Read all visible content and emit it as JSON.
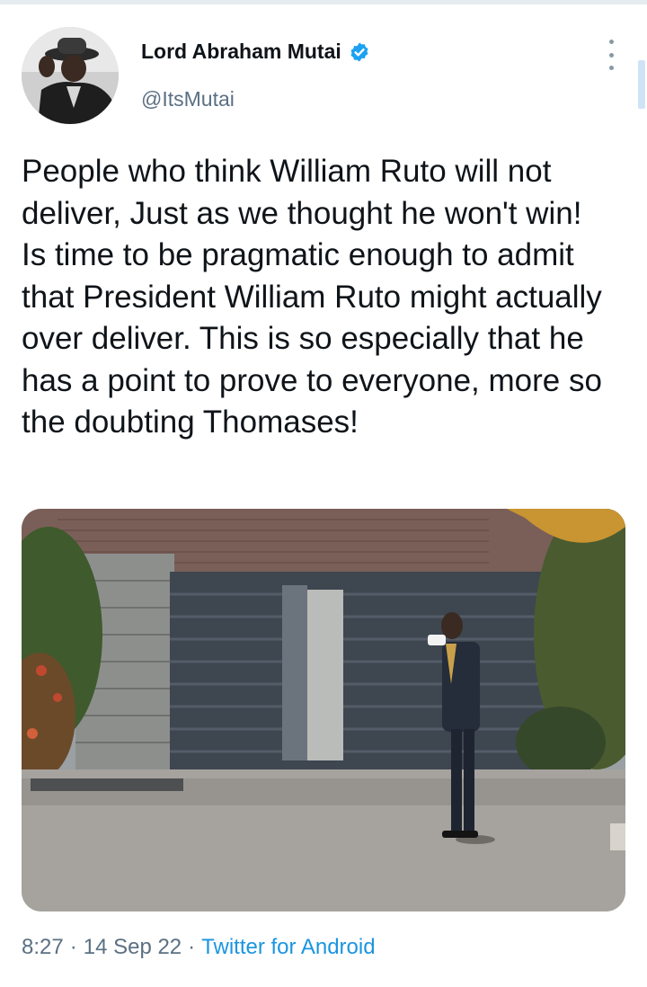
{
  "user": {
    "display_name": "Lord Abraham Mutai",
    "handle": "@ItsMutai",
    "verified": true
  },
  "tweet": {
    "text": "People who think William Ruto will not deliver, Just as we thought he won't win! Is time to be pragmatic enough to admit that President William Ruto might actually over deliver. This is so especially that he has a point to prove to everyone, more so the doubting Thomases!"
  },
  "meta": {
    "time": "8:27",
    "separator": "·",
    "date": "14 Sep 22",
    "source": "Twitter for Android"
  },
  "icons": {
    "verified": "verified-badge-icon",
    "more": "more-vertical-icon"
  },
  "colors": {
    "text": "#0f1419",
    "secondary": "#5b7083",
    "link": "#1b95e0",
    "verified": "#1da1f2"
  }
}
